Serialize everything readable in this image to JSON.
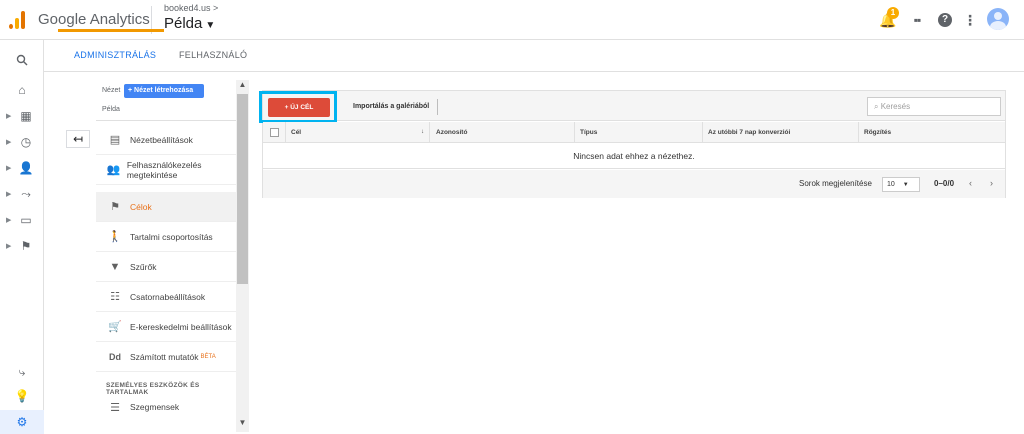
{
  "topbar": {
    "brand": "Google Analytics",
    "account": "booked4.us >",
    "property": "Példa",
    "notification_count": "1"
  },
  "tabs": [
    {
      "label": "ADMINISZTRÁLÁS",
      "active": true
    },
    {
      "label": "FELHASZNÁLÓ",
      "active": false
    }
  ],
  "view_panel": {
    "label": "Nézet",
    "create_button": "+ Nézet létrehozása",
    "view_name": "Példa",
    "items": [
      {
        "label": "Nézetbeállítások",
        "icon": "document-icon"
      },
      {
        "label": "Felhasználókezelés megtekintése",
        "icon": "people-icon"
      },
      {
        "label": "Célok",
        "icon": "flag-icon",
        "active": true
      },
      {
        "label": "Tartalmi csoportosítás",
        "icon": "person-walk-icon"
      },
      {
        "label": "Szűrők",
        "icon": "filter-icon"
      },
      {
        "label": "Csatornabeállítások",
        "icon": "channel-icon"
      },
      {
        "label": "E-kereskedelmi beállítások",
        "icon": "cart-icon"
      },
      {
        "label": "Számított mutatók",
        "icon": "dd-icon",
        "badge": "BÉTA"
      }
    ],
    "section_title": "SZEMÉLYES ESZKÖZÖK ÉS TARTALMAK",
    "section_items": [
      {
        "label": "Szegmensek",
        "icon": "segments-icon"
      }
    ]
  },
  "goals": {
    "new_goal_button": "+ ÚJ CÉL",
    "import_link": "Importálás a galériából",
    "search_placeholder": "Keresés",
    "columns": [
      "Cél",
      "Azonosító",
      "Típus",
      "Az utóbbi 7 nap konverziói",
      "Rögzítés"
    ],
    "empty_message": "Nincsen adat ehhez a nézethez.",
    "rows_label": "Sorok megjelenítése",
    "rows_value": "10",
    "range": "0–0/0"
  },
  "colors": {
    "accent_blue": "#1a73e8",
    "tab_underline": "#f29900",
    "new_goal_red": "#dd4b39",
    "highlight": "#00b3f0",
    "active_item": "#e8711a"
  }
}
